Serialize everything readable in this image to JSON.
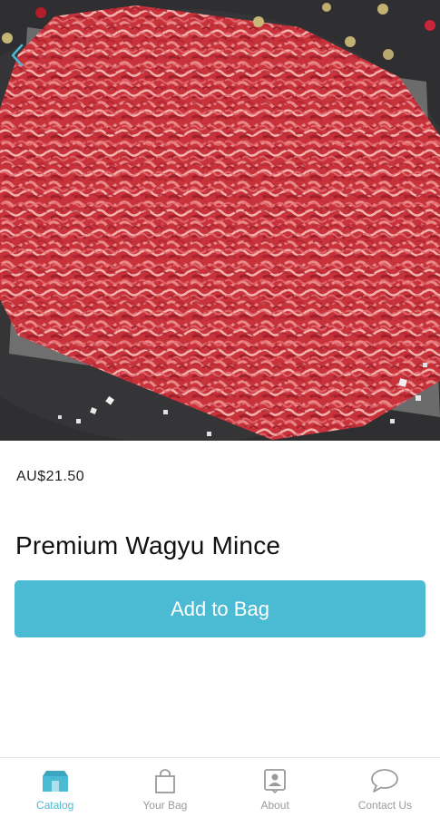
{
  "product": {
    "price": "AU$21.50",
    "name": "Premium Wagyu Mince",
    "add_to_bag_label": "Add to Bag",
    "image_icon": "product-photo"
  },
  "nav": {
    "back_icon": "chevron-left-icon"
  },
  "tabbar": {
    "active_color": "#4bbad3",
    "inactive_color": "#9a9a9a",
    "tabs": [
      {
        "label": "Catalog",
        "icon": "storefront-icon",
        "active": true
      },
      {
        "label": "Your Bag",
        "icon": "shopping-bag-icon",
        "active": false
      },
      {
        "label": "About",
        "icon": "contact-card-icon",
        "active": false
      },
      {
        "label": "Contact Us",
        "icon": "speech-bubble-icon",
        "active": false
      }
    ]
  },
  "colors": {
    "accent": "#4bbad3",
    "meat": "#c8323a"
  }
}
